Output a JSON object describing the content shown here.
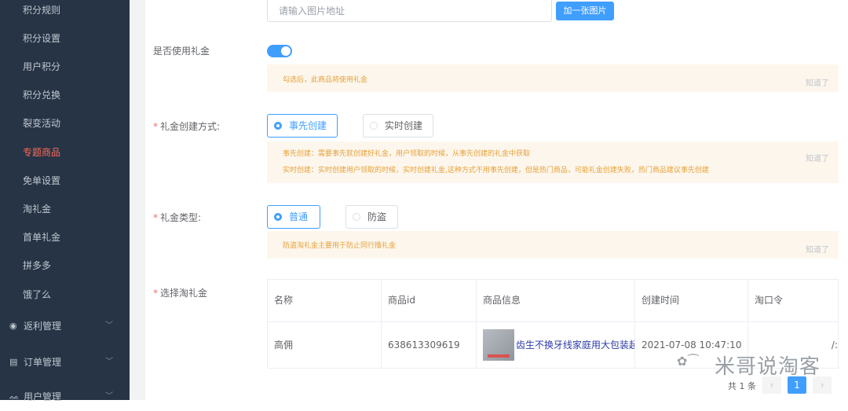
{
  "sidebar": {
    "items": [
      {
        "label": "积分规则"
      },
      {
        "label": "积分设置"
      },
      {
        "label": "用户积分"
      },
      {
        "label": "积分兑换"
      },
      {
        "label": "裂变活动"
      },
      {
        "label": "专题商品",
        "active": true
      },
      {
        "label": "免单设置"
      },
      {
        "label": "淘礼金"
      },
      {
        "label": "首单礼金"
      },
      {
        "label": "拼多多"
      },
      {
        "label": "饿了么"
      }
    ],
    "groups": [
      {
        "label": "返利管理",
        "icon": "rebate-icon"
      },
      {
        "label": "订单管理",
        "icon": "order-icon"
      },
      {
        "label": "用户管理",
        "icon": "user-icon"
      }
    ]
  },
  "form": {
    "image_input_placeholder": "请输入图片地址",
    "add_image_button": "加一张图片",
    "use_gift_label": "是否使用礼金",
    "use_gift_on": true,
    "use_gift_alert": "勾选后，此商品将使用礼金",
    "alert_close": "知道了",
    "create_mode": {
      "label": "礼金创建方式:",
      "options": [
        "事先创建",
        "实时创建"
      ],
      "selected": "事先创建",
      "alert_lines": [
        "事先创建：需要事先就创建好礼金，用户领取的时候，从事先创建的礼金中获取",
        "实时创建：实时创建用户领取的时候，实时创建礼金,这种方式不用事先创建，但是热门商品，可能礼金创建失败，热门商品建议事先创建"
      ]
    },
    "gift_type": {
      "label": "礼金类型:",
      "options": [
        "普通",
        "防盗"
      ],
      "selected": "普通",
      "alert": "防盗淘礼金主要用于防止同行撸礼金"
    },
    "select_gift": {
      "label": "选择淘礼金",
      "columns": [
        "名称",
        "商品id",
        "商品信息",
        "创建时间",
        "淘口令"
      ],
      "rows": [
        {
          "name": "高佣",
          "product_id": "638613309619",
          "product_info": "齿生不换牙线家庭用大包装超细",
          "created": "2021-07-08 10:47:10",
          "token": "/:"
        }
      ]
    }
  },
  "pagination": {
    "total": "共 1 条",
    "prev": "‹",
    "current": "1",
    "next": "›"
  },
  "watermark": {
    "text": "米哥说淘客"
  },
  "colors": {
    "primary": "#409eff",
    "sidebar_bg": "#263445",
    "active_menu": "#ff6a59",
    "warning_bg": "#fdf6ec",
    "warning_text": "#e6a23c"
  }
}
